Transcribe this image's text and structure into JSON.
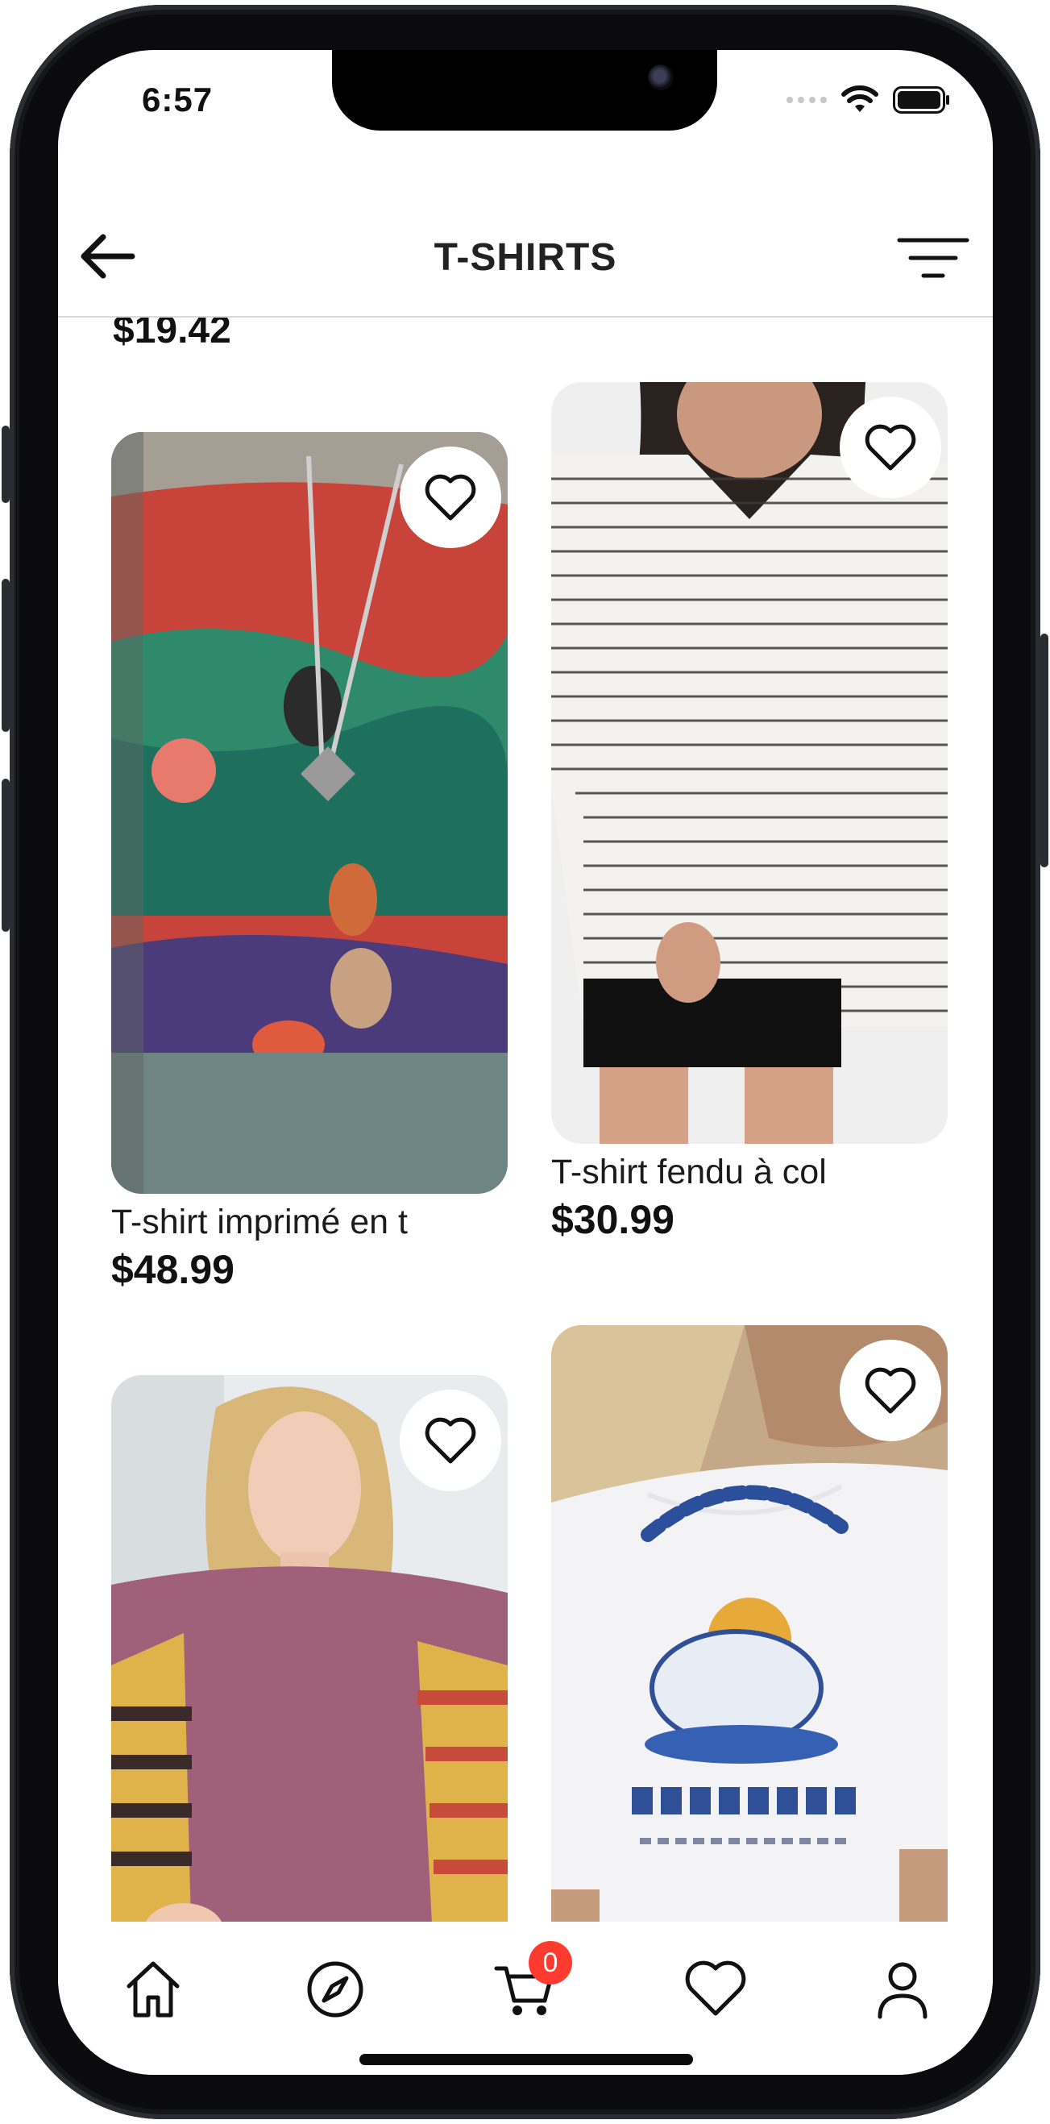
{
  "status": {
    "time": "6:57"
  },
  "header": {
    "title": "T-SHIRTS"
  },
  "previous_item": {
    "price": "$19.42"
  },
  "products": [
    {
      "name": "T-shirt imprimé en t",
      "price": "$48.99"
    },
    {
      "name": "T-shirt fendu à col",
      "price": "$30.99"
    },
    {
      "name": "",
      "price": ""
    },
    {
      "name": "",
      "price": ""
    }
  ],
  "cart": {
    "count": "0"
  },
  "icons": {
    "back": "arrow-left-icon",
    "filter": "filter-icon",
    "favorite": "heart-icon",
    "home": "home-icon",
    "explore": "compass-icon",
    "cart": "cart-icon",
    "wishlist": "heart-icon",
    "profile": "user-icon"
  },
  "colors": {
    "badge": "#ff3b30"
  }
}
